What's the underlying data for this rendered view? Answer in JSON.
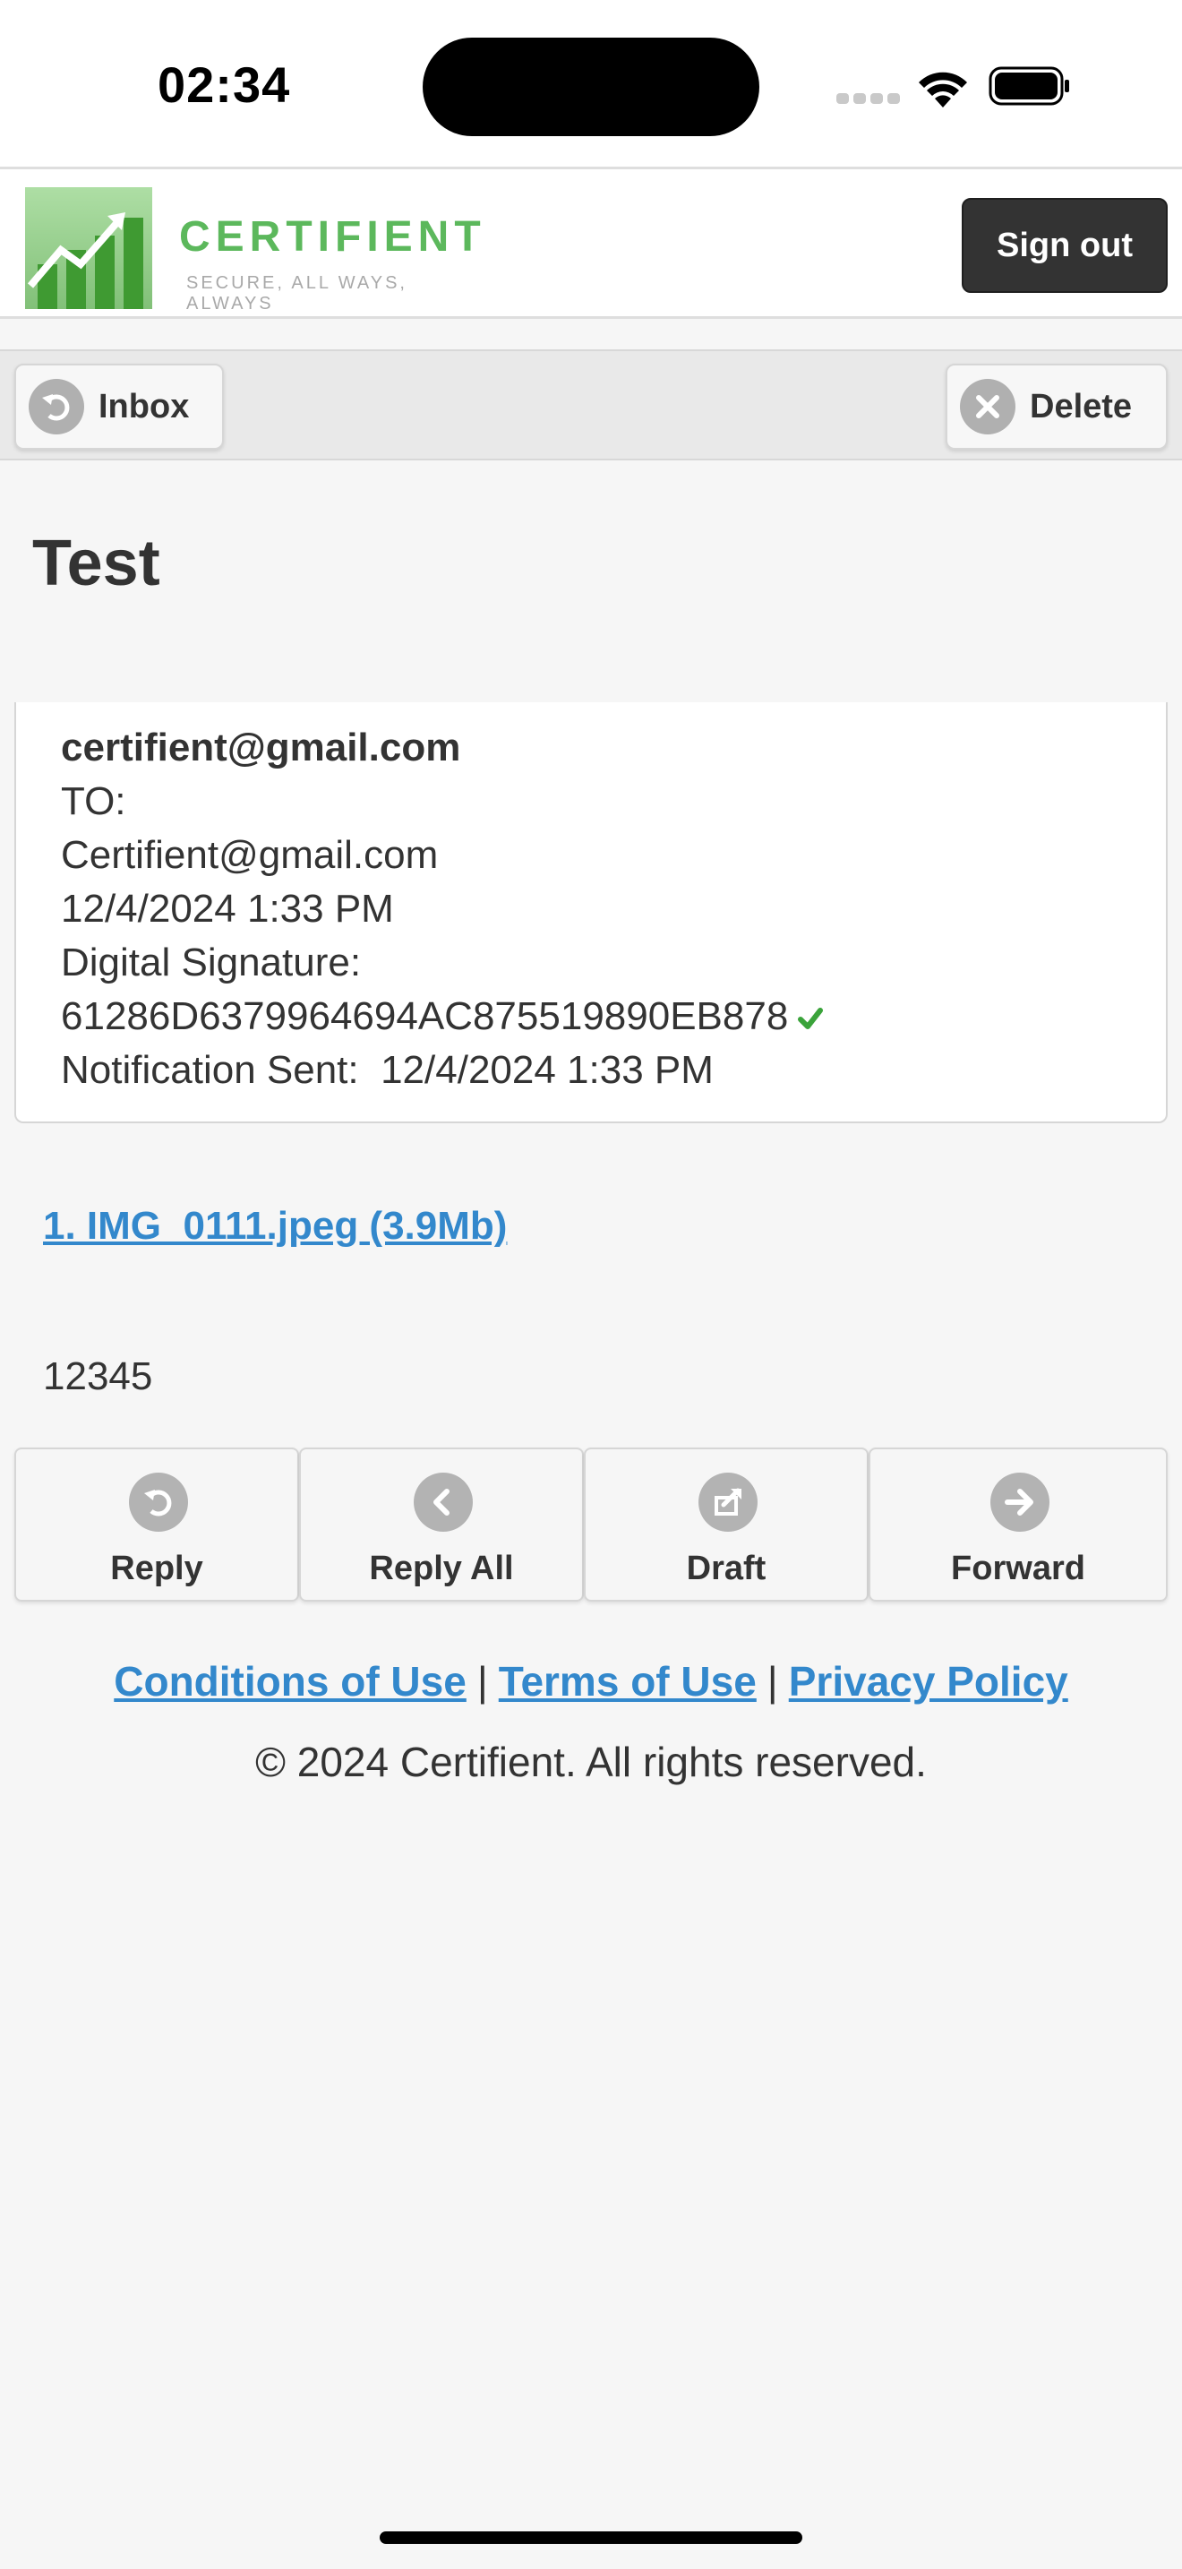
{
  "status_bar": {
    "time": "02:34"
  },
  "header": {
    "logo_text": "CERTIFIENT",
    "logo_tagline": "SECURE, ALL WAYS, ALWAYS",
    "signout_label": "Sign out"
  },
  "toolbar": {
    "inbox_label": "Inbox",
    "delete_label": "Delete"
  },
  "message": {
    "subject": "Test",
    "from": "certifient@gmail.com",
    "to_label": "TO:",
    "to": "Certifient@gmail.com",
    "date": "12/4/2024 1:33 PM",
    "signature_label": "Digital Signature:",
    "signature": "61286D6379964694AC875519890EB878",
    "notification_label": "Notification Sent:",
    "notification_date": "12/4/2024 1:33 PM",
    "attachment": "1. IMG_0111.jpeg (3.9Mb)",
    "body": "12345"
  },
  "actions": {
    "reply": "Reply",
    "reply_all": "Reply All",
    "draft": "Draft",
    "forward": "Forward"
  },
  "footer": {
    "conditions": "Conditions of Use",
    "terms": "Terms of Use",
    "privacy": "Privacy Policy",
    "separator": "|",
    "copyright": "© 2024 Certifient. All rights reserved."
  },
  "colors": {
    "link": "#3388cc",
    "brand_green": "#5cb85c",
    "dark_button": "#333333"
  },
  "icons": {
    "inbox": "back-arrow-icon",
    "delete": "close-icon",
    "reply": "reply-icon",
    "reply_all": "chevron-left-icon",
    "draft": "edit-icon",
    "forward": "arrow-right-icon",
    "verified": "check-icon"
  }
}
